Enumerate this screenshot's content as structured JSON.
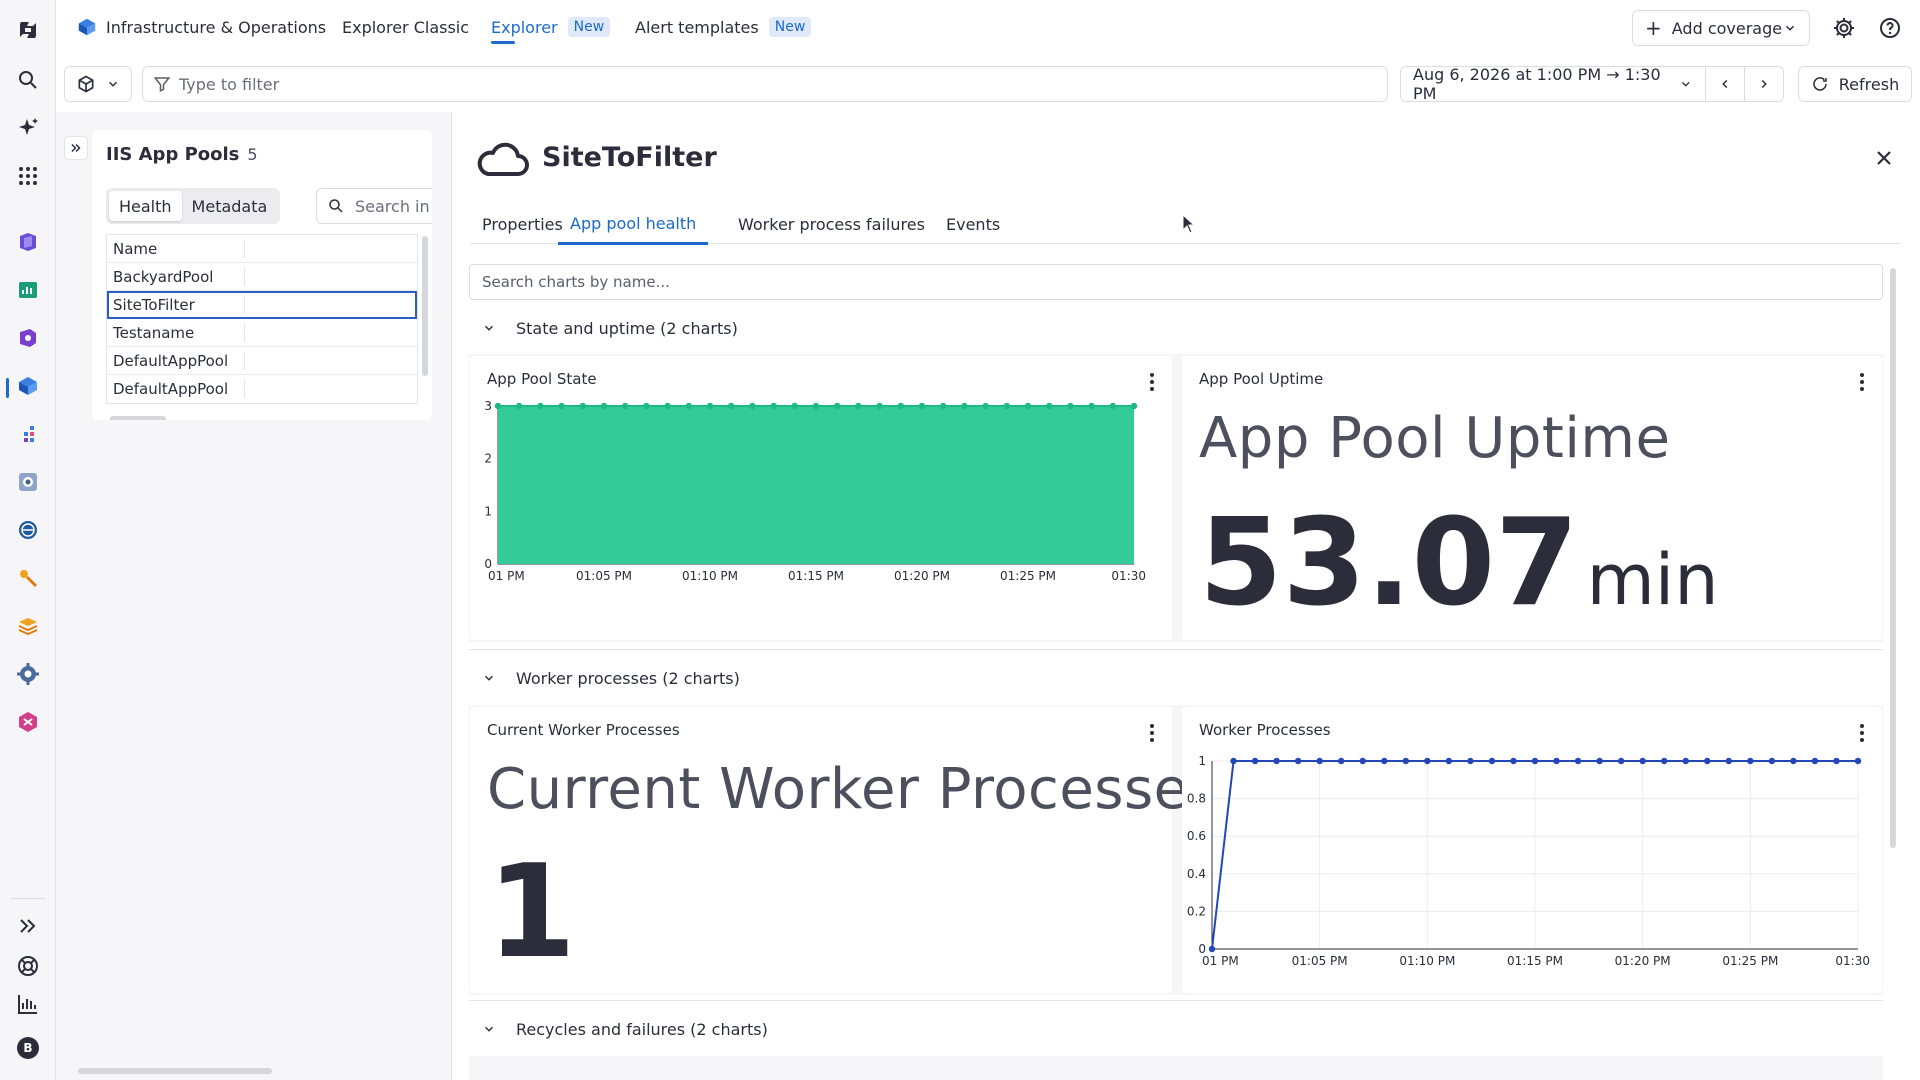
{
  "topnav": {
    "app_title": "Infrastructure & Operations",
    "explorer_classic": "Explorer Classic",
    "explorer": "Explorer",
    "explorer_badge": "New",
    "alert_templates": "Alert templates",
    "alert_badge": "New",
    "add_coverage": "Add coverage"
  },
  "filterbar": {
    "filter_placeholder": "Type to filter",
    "timeframe": "Aug 6, 2026 at 1:00 PM → 1:30 PM",
    "refresh": "Refresh"
  },
  "list": {
    "title": "IIS App Pools",
    "count": "5",
    "tab_health": "Health",
    "tab_metadata": "Metadata",
    "search_placeholder": "Search in results",
    "column_name": "Name",
    "rows": [
      "BackyardPool",
      "SiteToFilter",
      "Testaname",
      "DefaultAppPool",
      "DefaultAppPool"
    ],
    "selected_index": 1
  },
  "details": {
    "title": "SiteToFilter",
    "tabs": [
      "Properties",
      "App pool health",
      "Worker process failures",
      "Events"
    ],
    "active_tab": "App pool health",
    "search_placeholder": "Search charts by name...",
    "groups": [
      "State and uptime (2 charts)",
      "Worker processes (2 charts)",
      "Recycles and failures (2 charts)"
    ],
    "cards": {
      "app_pool_state": {
        "title": "App Pool State"
      },
      "app_pool_uptime": {
        "title": "App Pool Uptime",
        "label": "App Pool Uptime",
        "value": "53.07",
        "unit": "min"
      },
      "current_worker_processes": {
        "title": "Current Worker Processes",
        "label": "Current Worker Processes",
        "value": "1"
      },
      "worker_processes": {
        "title": "Worker Processes"
      }
    }
  },
  "colors": {
    "accent": "#1a6bcc",
    "state_fill": "#33cc99",
    "state_point": "#1fb985",
    "worker_line": "#2347b8"
  },
  "chart_data": [
    {
      "id": "app-pool-state",
      "type": "area",
      "title": "App Pool State",
      "x_labels": [
        "01 PM",
        "01:05 PM",
        "01:10 PM",
        "01:15 PM",
        "01:20 PM",
        "01:25 PM",
        "01:30"
      ],
      "y_ticks": [
        0,
        1,
        2,
        3
      ],
      "ylim": [
        0,
        3
      ],
      "xlim": [
        0,
        30
      ],
      "series": [
        {
          "x": [
            0,
            1,
            2,
            3,
            4,
            5,
            6,
            7,
            8,
            9,
            10,
            11,
            12,
            13,
            14,
            15,
            16,
            17,
            18,
            19,
            20,
            21,
            22,
            23,
            24,
            25,
            26,
            27,
            28,
            29
          ],
          "y": [
            3,
            3,
            3,
            3,
            3,
            3,
            3,
            3,
            3,
            3,
            3,
            3,
            3,
            3,
            3,
            3,
            3,
            3,
            3,
            3,
            3,
            3,
            3,
            3,
            3,
            3,
            3,
            3,
            3,
            3
          ]
        }
      ]
    },
    {
      "id": "worker-processes",
      "type": "line",
      "title": "Worker Processes",
      "x_labels": [
        "01 PM",
        "01:05 PM",
        "01:10 PM",
        "01:15 PM",
        "01:20 PM",
        "01:25 PM",
        "01:30"
      ],
      "y_ticks": [
        0,
        0.2,
        0.4,
        0.6,
        0.8,
        1
      ],
      "ylim": [
        0,
        1
      ],
      "xlim": [
        0,
        30
      ],
      "series": [
        {
          "x": [
            0,
            1,
            2,
            3,
            4,
            5,
            6,
            7,
            8,
            9,
            10,
            11,
            12,
            13,
            14,
            15,
            16,
            17,
            18,
            19,
            20,
            21,
            22,
            23,
            24,
            25,
            26,
            27,
            28,
            29
          ],
          "y": [
            0,
            1,
            1,
            1,
            1,
            1,
            1,
            1,
            1,
            1,
            1,
            1,
            1,
            1,
            1,
            1,
            1,
            1,
            1,
            1,
            1,
            1,
            1,
            1,
            1,
            1,
            1,
            1,
            1,
            1
          ]
        }
      ]
    }
  ]
}
